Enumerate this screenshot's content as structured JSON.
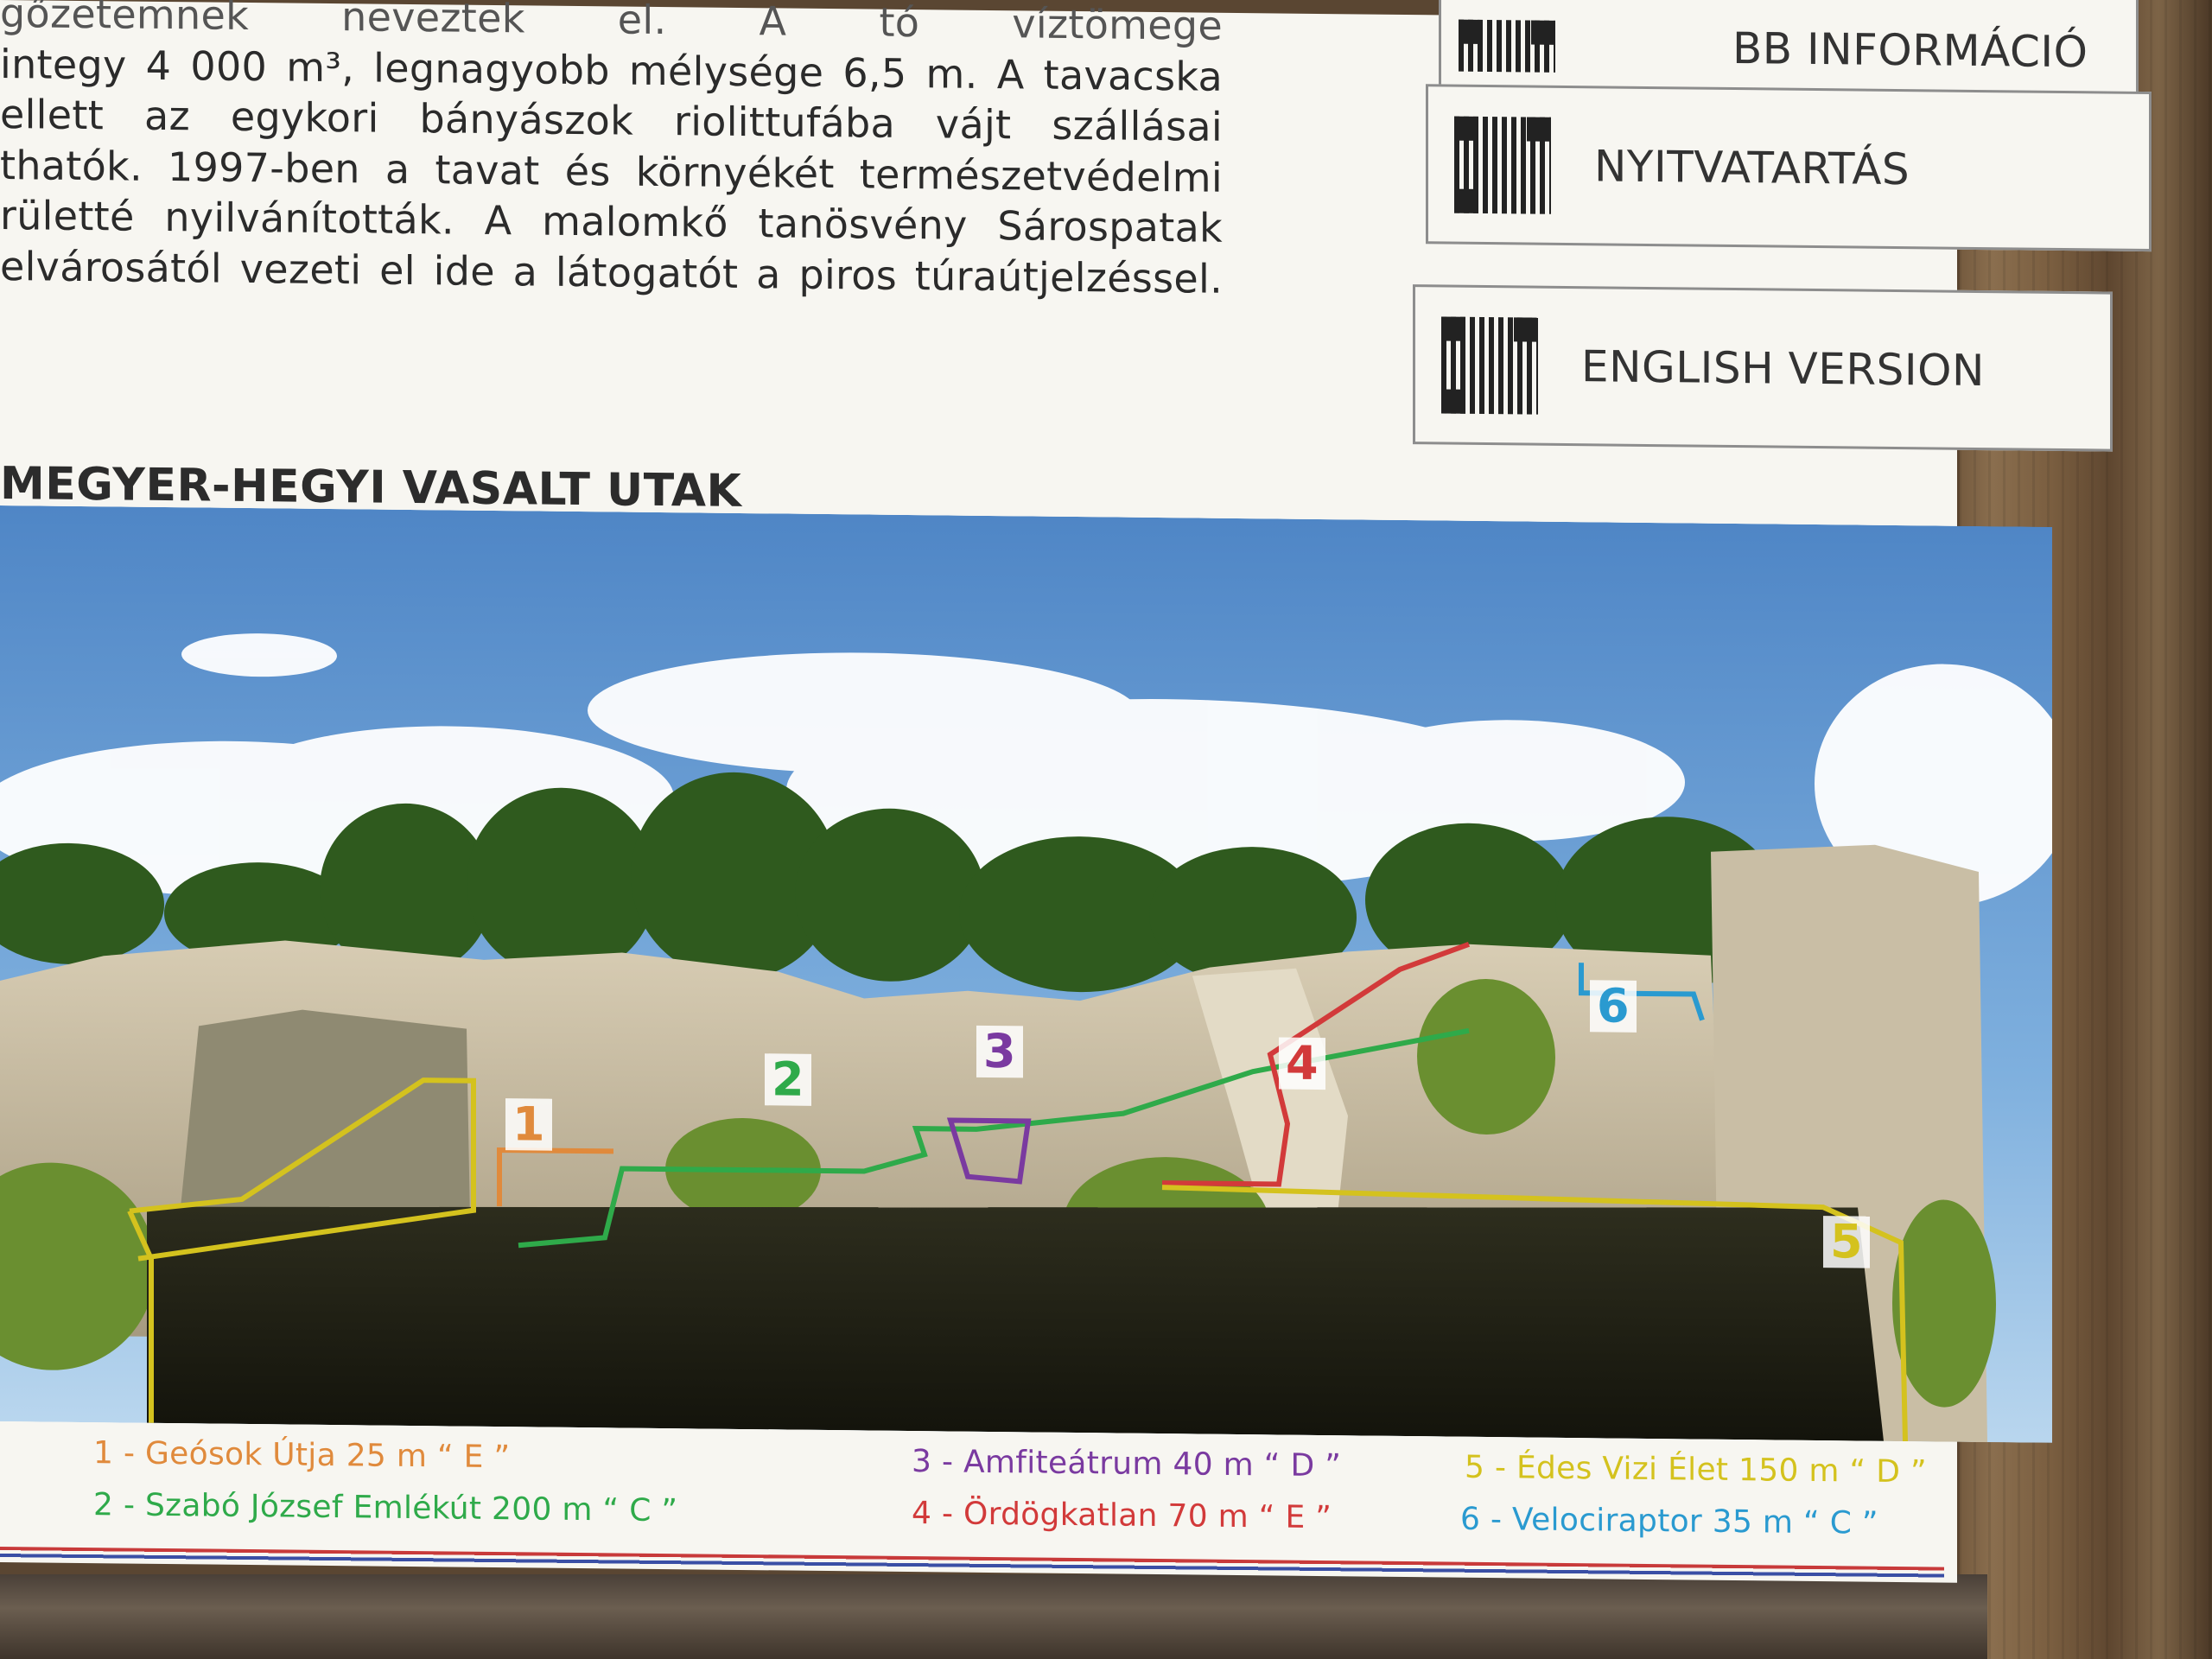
{
  "intro_lines": [
    "gőzetemnek neveztek el. A tó víztömege",
    "integy 4 000 m³, legnagyobb mélysége 6,5 m. A tavacska",
    "ellett az egykori bányászok riolittufába vájt szállásai",
    "thatók. 1997-ben a tavat és környékét természetvédelmi",
    "rületté nyilvánították. A malomkő tanösvény Sárospatak",
    "elvárosától vezeti el ide a látogatót a piros túraútjelzéssel."
  ],
  "qr_buttons": {
    "info": "BB INFORMÁCIÓ",
    "hours": "NYITVATARTÁS",
    "english": "ENGLISH VERSION"
  },
  "section_title": "MEGYER-HEGYI VASALT UTAK",
  "route_markers": [
    "1",
    "2",
    "3",
    "4",
    "5",
    "6"
  ],
  "legend": {
    "r1": "1 - Geósok Útja 25 m “ E ”",
    "r2": "2 - Szabó József Emlékút 200 m “ C ”",
    "r3": "3 - Amfiteátrum 40 m “ D ”",
    "r4": "4 - Ördögkatlan 70 m “ E ”",
    "r5": "5 - Édes Vizi Élet 150 m “ D ”",
    "r6": "6 - Velociraptor 35 m “ C ”"
  },
  "colors": {
    "route1": "#e08a3c",
    "route2": "#2faa4a",
    "route3": "#7a3aa0",
    "route4": "#d23a3a",
    "route5": "#d4c21e",
    "route6": "#2a9ad0"
  }
}
